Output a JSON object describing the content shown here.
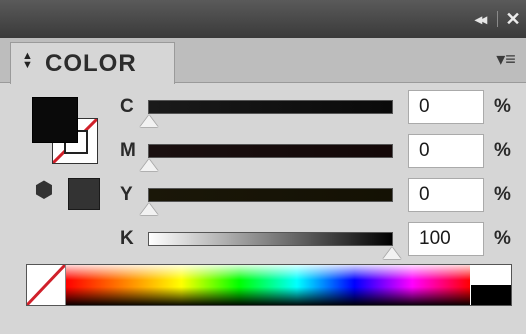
{
  "panel": {
    "tab_label": "COLOR",
    "tab_arrows_icon": "updown-arrows-icon",
    "collapse_glyph": "◂◂",
    "close_glyph": "✕",
    "menu_glyph": "▾≡"
  },
  "swatches": {
    "fill_color": "#0a0a0a",
    "stroke_color": "none",
    "out_of_gamut_color": "#333333"
  },
  "channels": [
    {
      "label": "C",
      "value": "0",
      "unit": "%",
      "level": 0,
      "track_from": "#1a1a1a",
      "track_to": "#0a0a0a"
    },
    {
      "label": "M",
      "value": "0",
      "unit": "%",
      "level": 0,
      "track_from": "#1a1010",
      "track_to": "#140808"
    },
    {
      "label": "Y",
      "value": "0",
      "unit": "%",
      "level": 0,
      "track_from": "#1a1708",
      "track_to": "#141104"
    },
    {
      "label": "K",
      "value": "100",
      "unit": "%",
      "level": 100,
      "track_from": "#ffffff",
      "track_to": "#000000"
    }
  ]
}
